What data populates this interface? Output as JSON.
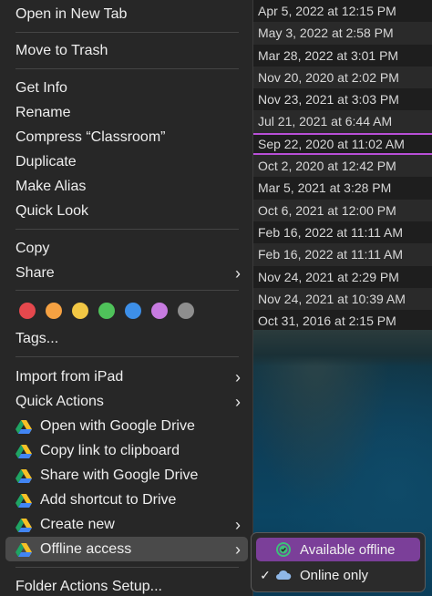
{
  "menu": {
    "open_new_tab": "Open in New Tab",
    "move_to_trash": "Move to Trash",
    "get_info": "Get Info",
    "rename": "Rename",
    "compress": "Compress “Classroom”",
    "duplicate": "Duplicate",
    "make_alias": "Make Alias",
    "quick_look": "Quick Look",
    "copy": "Copy",
    "share": "Share",
    "tags": "Tags...",
    "import_ipad": "Import from iPad",
    "quick_actions": "Quick Actions",
    "gd_open": "Open with Google Drive",
    "gd_copy_link": "Copy link to clipboard",
    "gd_share": "Share with Google Drive",
    "gd_shortcut": "Add shortcut to Drive",
    "create_new": "Create new",
    "offline_access": "Offline access",
    "folder_actions": "Folder Actions Setup...",
    "chevron": "›",
    "tag_colors": [
      "#e5484d",
      "#f5a142",
      "#f2c744",
      "#4fc25a",
      "#3d8fe8",
      "#c77be0",
      "#8e8e8e"
    ]
  },
  "submenu": {
    "available_offline": "Available offline",
    "online_only": "Online only",
    "checkmark": "✓",
    "available_icon": "offline-check-icon",
    "online_icon": "cloud-icon"
  },
  "dates": [
    "Apr 5, 2022 at 12:15 PM",
    "May 3, 2022 at 2:58 PM",
    "Mar 28, 2022 at 3:01 PM",
    "Nov 20, 2020 at 2:02 PM",
    "Nov 23, 2021 at 3:03 PM",
    "Jul 21, 2021 at 6:44 AM",
    "Sep 22, 2020 at 11:02 AM",
    "Oct 2, 2020 at 12:42 PM",
    "Mar 5, 2021 at 3:28 PM",
    "Oct 6, 2021 at 12:00 PM",
    "Feb 16, 2022 at 11:11 AM",
    "Feb 16, 2022 at 11:11 AM",
    "Nov 24, 2021 at 2:29 PM",
    "Nov 24, 2021 at 10:39 AM",
    "Oct 31, 2016 at 2:15 PM"
  ],
  "colors": {
    "selection_outline": "#b84fd6",
    "submenu_active": "#7b3f99",
    "menu_bg": "#272727"
  }
}
